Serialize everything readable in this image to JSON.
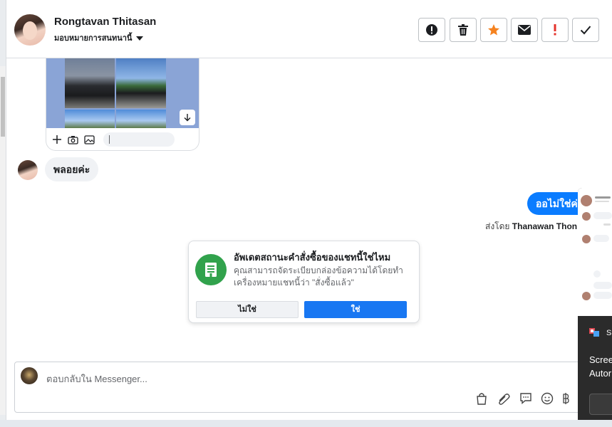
{
  "header": {
    "contact_name": "Rongtavan Thitasan",
    "assign_label": "มอบหมายการสนทนานี้",
    "actions": [
      "Mark as spam",
      "Delete",
      "Star",
      "Mark as unread",
      "Follow up",
      "Mark as done"
    ]
  },
  "messages": {
    "incoming_text": "พลอยค่ะ",
    "outgoing_text": "ออไม่ใช่ค่ะ",
    "sent_by_prefix": "ส่งโดย",
    "sent_by_name": "Thanawan Thon"
  },
  "dialog": {
    "title": "อัพเดตสถานะคำสั่งซื้อของแชทนี้ใช่ไหม",
    "body": "คุณสามารถจัดระเบียบกล่องข้อความได้โดยทำเครื่องหมายแชทนี้ว่า \"สั่งซื้อแล้ว\"",
    "no_label": "ไม่ใช่",
    "yes_label": "ใช่"
  },
  "composer": {
    "placeholder": "ตอบกลับใน Messenger..."
  },
  "overlay": {
    "app_name": "Sn",
    "line1": "Scree",
    "line2": "Autor"
  },
  "colors": {
    "brand_blue": "#1877f2",
    "outgoing_bubble": "#0a7cff",
    "success_green": "#31a24c",
    "star_orange": "#f5821f",
    "flag_red": "#e4322b"
  }
}
